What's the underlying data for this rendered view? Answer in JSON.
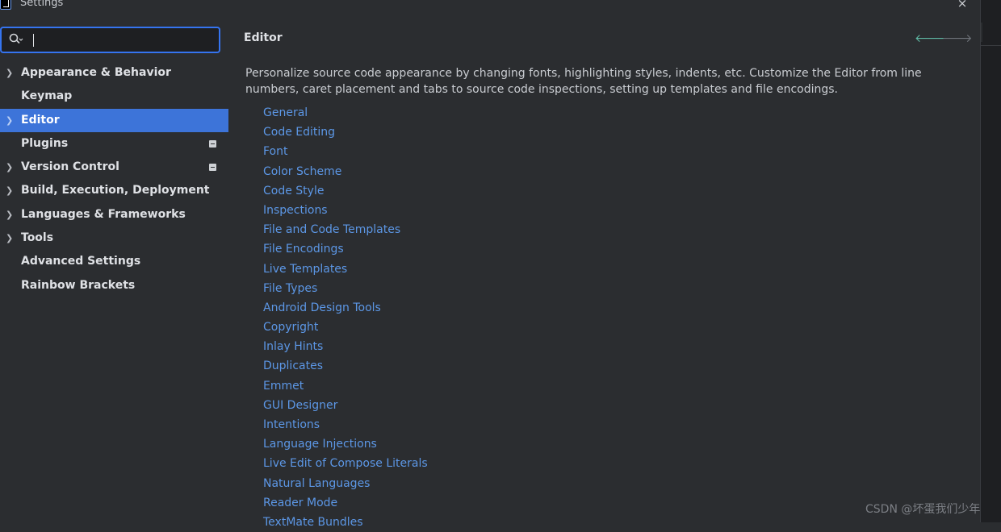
{
  "window": {
    "title": "Settings",
    "close_glyph": "×"
  },
  "search": {
    "value": "",
    "placeholder": ""
  },
  "sidebar": {
    "items": [
      {
        "label": "Appearance & Behavior",
        "expandable": true,
        "selected": false,
        "badge": false
      },
      {
        "label": "Keymap",
        "expandable": false,
        "selected": false,
        "badge": false
      },
      {
        "label": "Editor",
        "expandable": true,
        "selected": true,
        "badge": false
      },
      {
        "label": "Plugins",
        "expandable": false,
        "selected": false,
        "badge": true
      },
      {
        "label": "Version Control",
        "expandable": true,
        "selected": false,
        "badge": true
      },
      {
        "label": "Build, Execution, Deployment",
        "expandable": true,
        "selected": false,
        "badge": false
      },
      {
        "label": "Languages & Frameworks",
        "expandable": true,
        "selected": false,
        "badge": false
      },
      {
        "label": "Tools",
        "expandable": true,
        "selected": false,
        "badge": false
      },
      {
        "label": "Advanced Settings",
        "expandable": false,
        "selected": false,
        "badge": false
      },
      {
        "label": "Rainbow Brackets",
        "expandable": false,
        "selected": false,
        "badge": false
      }
    ]
  },
  "main": {
    "title": "Editor",
    "back_glyph": "🡐",
    "forward_glyph": "🡒",
    "description": "Personalize source code appearance by changing fonts, highlighting styles, indents, etc. Customize the Editor from line numbers, caret placement and tabs to source code inspections, setting up templates and file encodings.",
    "links": [
      "General",
      "Code Editing",
      "Font",
      "Color Scheme",
      "Code Style",
      "Inspections",
      "File and Code Templates",
      "File Encodings",
      "Live Templates",
      "File Types",
      "Android Design Tools",
      "Copyright",
      "Inlay Hints",
      "Duplicates",
      "Emmet",
      "GUI Designer",
      "Intentions",
      "Language Injections",
      "Live Edit of Compose Literals",
      "Natural Languages",
      "Reader Mode",
      "TextMate Bundles"
    ]
  },
  "watermark": "CSDN @坏蛋我们少年",
  "colors": {
    "background": "#2b2d30",
    "selection": "#3d74d9",
    "link": "#5c97e6",
    "focus_border": "#3574f0",
    "back_arrow": "#5fb8a3"
  }
}
